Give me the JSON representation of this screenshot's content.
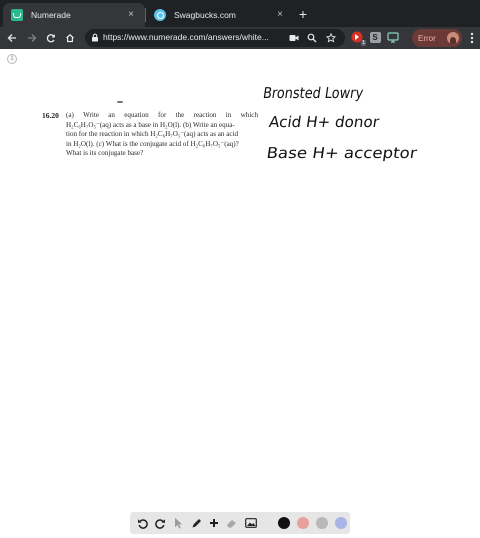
{
  "browser": {
    "tabs": [
      {
        "title": "Numerade",
        "active": true,
        "favicon": "numerade-favicon"
      },
      {
        "title": "Swagbucks.com",
        "active": false,
        "favicon": "swagbucks-favicon"
      }
    ],
    "close_glyph": "×",
    "new_tab_glyph": "+",
    "url": "https://www.numerade.com/answers/white...",
    "extensions": [
      {
        "name": "extension-red-icon",
        "badge": "1"
      },
      {
        "name": "extension-s-icon",
        "glyph": "S"
      },
      {
        "name": "extension-monitor-icon"
      }
    ],
    "status_chip": "Error"
  },
  "page": {
    "page_badge": "1",
    "question": {
      "number": "16.20",
      "lines": [
        "(a) Write an equation for the reaction in which",
        "H₂C₆H₇O₅⁻(aq) acts as a base in H₂O(l). (b) Write an equa-",
        "tion for the reaction in which H₂C₆H₇O₅⁻(aq) acts as an acid",
        "in H₂O(l). (c) What is the conjugate acid of H₂C₆H₇O₅⁻(aq)?",
        "What is its conjugate base?"
      ]
    },
    "handwritten_notes": [
      "Bronsted Lowry",
      "Acid H+ donor",
      "Base H+ acceptor"
    ]
  },
  "drawing_toolbar": {
    "tools": [
      "undo-icon",
      "redo-icon",
      "select-arrow-icon",
      "pen-icon",
      "add-icon",
      "eraser-icon",
      "image-icon"
    ],
    "colors": [
      "#111111",
      "#e8a29e",
      "#b8b8b8",
      "#a8b4e6"
    ]
  },
  "colors": {
    "tabstrip": "#202124",
    "toolbar": "#35363a",
    "error_chip": "#6b3a37",
    "error_text": "#f6aea9"
  }
}
